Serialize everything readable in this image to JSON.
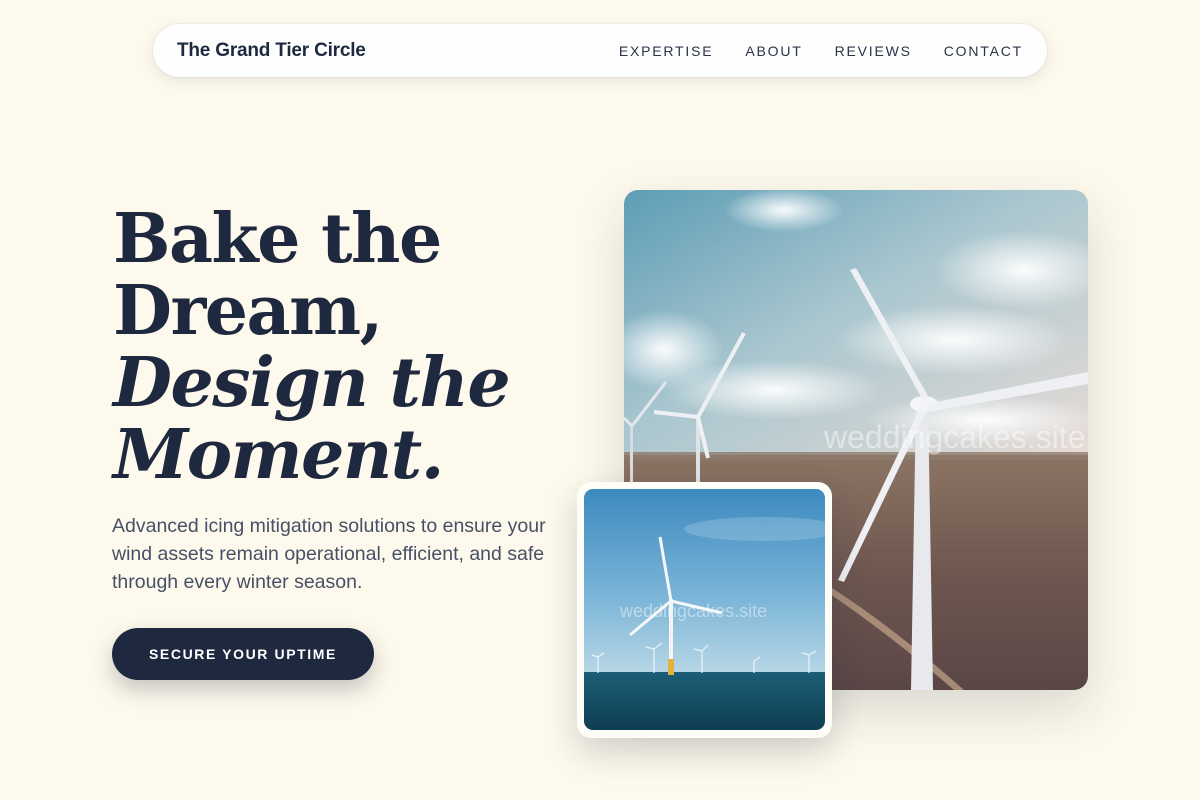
{
  "nav": {
    "brand": "The Grand Tier Circle",
    "links": [
      "EXPERTISE",
      "ABOUT",
      "REVIEWS",
      "CONTACT"
    ]
  },
  "hero": {
    "title_lines": [
      "Bake the",
      "Dream,",
      "Design the",
      "Moment."
    ],
    "subtitle": "Advanced icing mitigation solutions to ensure your wind assets remain operational, efficient, and safe through every winter season.",
    "cta_label": "SECURE YOUR UPTIME"
  },
  "images": {
    "main_watermark": "weddingcakes.site",
    "small_watermark": "weddingcakes.site"
  },
  "colors": {
    "background": "#fdf9ec",
    "navy": "#1e2940",
    "body_text": "#475066"
  }
}
